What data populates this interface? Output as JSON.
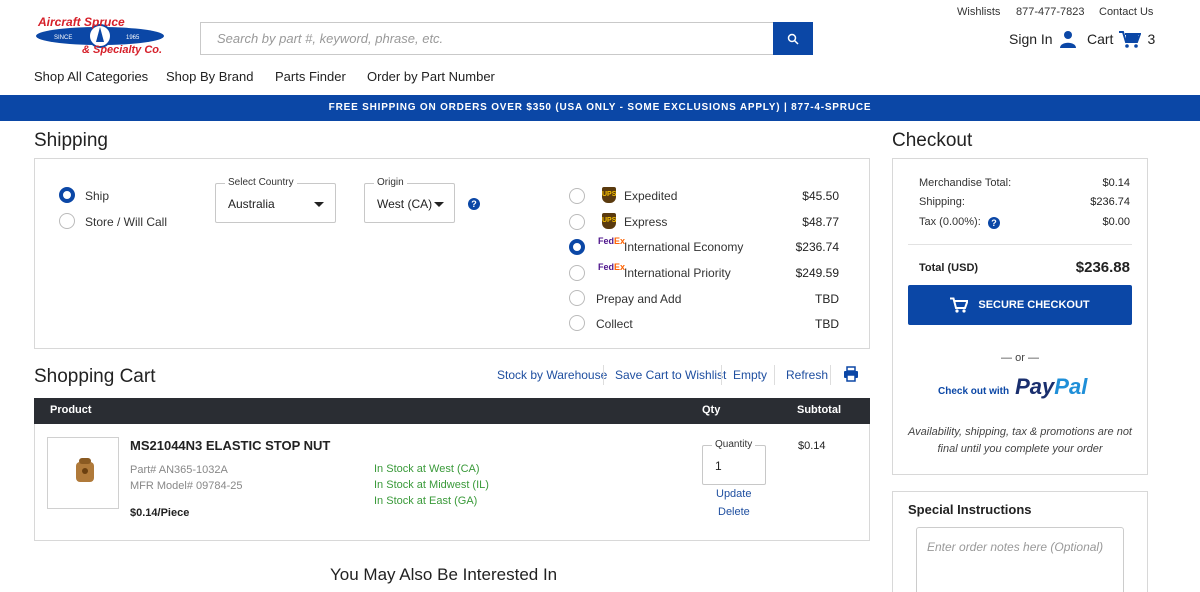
{
  "header": {
    "logo": {
      "line1": "Aircraft Spruce",
      "line2": "& Specialty Co.",
      "since": "SINCE",
      "year": "1965"
    },
    "search_placeholder": "Search by part #, keyword, phrase, etc.",
    "top_links": {
      "wishlists": "Wishlists",
      "phone": "877-477-7823",
      "contact": "Contact Us"
    },
    "sign_in": "Sign In",
    "cart_label": "Cart",
    "cart_count": "3",
    "nav": [
      "Shop All Categories",
      "Shop By Brand",
      "Parts Finder",
      "Order by Part Number"
    ],
    "banner": "FREE SHIPPING ON ORDERS OVER $350 (USA ONLY - SOME EXCLUSIONS APPLY) | 877-4-SPRUCE"
  },
  "shipping": {
    "title": "Shipping",
    "delivery_options": [
      {
        "label": "Ship",
        "selected": true
      },
      {
        "label": "Store / Will Call",
        "selected": false
      }
    ],
    "country": {
      "legend": "Select Country",
      "value": "Australia"
    },
    "origin": {
      "legend": "Origin",
      "value": "West (CA)"
    },
    "methods": [
      {
        "carrier": "ups",
        "name": "Expedited",
        "price": "$45.50",
        "selected": false
      },
      {
        "carrier": "ups",
        "name": "Express",
        "price": "$48.77",
        "selected": false
      },
      {
        "carrier": "fedex",
        "name": "International Economy",
        "price": "$236.74",
        "selected": true
      },
      {
        "carrier": "fedex",
        "name": "International Priority",
        "price": "$249.59",
        "selected": false
      },
      {
        "carrier": "",
        "name": "Prepay and Add",
        "price": "TBD",
        "selected": false
      },
      {
        "carrier": "",
        "name": "Collect",
        "price": "TBD",
        "selected": false
      }
    ],
    "ups_logo_text": "UPS",
    "fedex_fe": "Fed",
    "fedex_ex": "Ex"
  },
  "cart": {
    "title": "Shopping Cart",
    "actions": {
      "stock": "Stock by Warehouse",
      "save": "Save Cart to Wishlist",
      "empty": "Empty",
      "refresh": "Refresh"
    },
    "columns": {
      "product": "Product",
      "qty": "Qty",
      "subtotal": "Subtotal"
    },
    "item": {
      "name": "MS21044N3 ELASTIC STOP NUT",
      "part": "Part# AN365-1032A",
      "mfr": "MFR Model# 09784-25",
      "unit_price": "$0.14/Piece",
      "stock": [
        "In Stock at West (CA)",
        "In Stock at Midwest (IL)",
        "In Stock at East (GA)"
      ],
      "quantity_legend": "Quantity",
      "quantity": "1",
      "update": "Update",
      "delete": "Delete",
      "subtotal": "$0.14"
    },
    "recommend_title": "You May Also Be Interested In"
  },
  "checkout": {
    "title": "Checkout",
    "merchandise_label": "Merchandise Total:",
    "merchandise_value": "$0.14",
    "shipping_label": "Shipping:",
    "shipping_value": "$236.74",
    "tax_label": "Tax (0.00%):",
    "tax_value": "$0.00",
    "total_label": "Total (USD)",
    "total_value": "$236.88",
    "secure_button": "SECURE CHECKOUT",
    "or": "— or —",
    "paypal_prefix": "Check out with",
    "paypal_pay": "Pay",
    "paypal_pal": "Pal",
    "note": "Availability, shipping, tax & promotions are not final until you complete your order"
  },
  "instructions": {
    "title": "Special Instructions",
    "placeholder": "Enter order notes here (Optional)"
  },
  "help_glyph": "?",
  "colors": {
    "brand": "#0b47a6",
    "header_dark": "#2a2d33",
    "in_stock": "#3a9a3a",
    "logo_red": "#d6202a"
  }
}
